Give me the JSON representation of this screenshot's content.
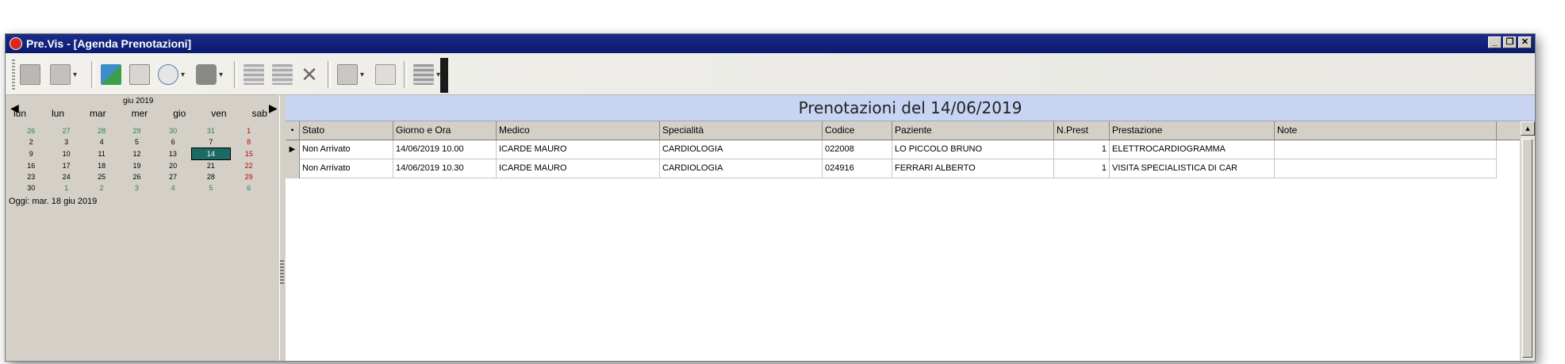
{
  "window": {
    "title": "Pre.Vis - [Agenda Prenotazioni]"
  },
  "toolbar": {
    "buttons": [
      {
        "icon": "record-icon"
      },
      {
        "icon": "edit-record-icon"
      },
      {
        "icon": "export-icon"
      },
      {
        "icon": "document-icon"
      },
      {
        "icon": "print-preview-icon"
      },
      {
        "icon": "printer-icon"
      },
      {
        "icon": "grid-add-icon"
      },
      {
        "icon": "grid-edit-icon"
      },
      {
        "icon": "delete-icon"
      },
      {
        "icon": "copy-icon"
      },
      {
        "icon": "clear-icon"
      },
      {
        "icon": "forward-icon"
      }
    ]
  },
  "calendar": {
    "month_label": "giu 2019",
    "day_names": [
      "lun",
      "lun",
      "mar",
      "mer",
      "gio",
      "ven",
      "sab"
    ],
    "weeks": [
      [
        "26",
        "27",
        "28",
        "29",
        "30",
        "31",
        "1"
      ],
      [
        "2",
        "3",
        "4",
        "5",
        "6",
        "7",
        "8"
      ],
      [
        "9",
        "10",
        "11",
        "12",
        "13",
        "14",
        "15"
      ],
      [
        "16",
        "17",
        "18",
        "19",
        "20",
        "21",
        "22"
      ],
      [
        "23",
        "24",
        "25",
        "26",
        "27",
        "28",
        "29"
      ],
      [
        "30",
        "1",
        "2",
        "3",
        "4",
        "5",
        "6"
      ]
    ],
    "today_text": "Oggi: mar. 18 giu 2019",
    "selected_day": "14"
  },
  "main": {
    "title": "Prenotazioni del 14/06/2019",
    "columns": [
      "Stato",
      "Giorno e Ora",
      "Medico",
      "Specialità",
      "Codice",
      "Paziente",
      "N.Prest",
      "Prestazione",
      "Note"
    ],
    "rows": [
      {
        "stato": "Non Arrivato",
        "giorno_ora": "14/06/2019 10.00",
        "medico": "ICARDE MAURO",
        "specialita": "CARDIOLOGIA",
        "codice": "022008",
        "paziente": "LO PICCOLO BRUNO",
        "n_prest": "1",
        "prestazione": "ELETTROCARDIOGRAMMA",
        "note": ""
      },
      {
        "stato": "Non Arrivato",
        "giorno_ora": "14/06/2019 10.30",
        "medico": "ICARDE MAURO",
        "specialita": "CARDIOLOGIA",
        "codice": "024916",
        "paziente": "FERRARI ALBERTO",
        "n_prest": "1",
        "prestazione": "VISITA SPECIALISTICA DI CAR",
        "note": ""
      }
    ]
  },
  "colors": {
    "title_bar": "#0a1a6e",
    "header_band": "#c7d5f3",
    "today_cell": "#1c6a63",
    "weekend": "#c00000"
  }
}
